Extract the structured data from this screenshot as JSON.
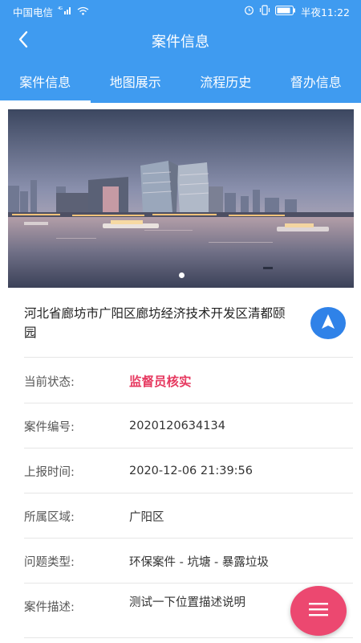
{
  "status_bar": {
    "carrier": "中国电信",
    "signal": "4G",
    "time_label": "半夜11:22"
  },
  "header": {
    "title": "案件信息",
    "back_icon": "chevron-left-icon"
  },
  "tabs": [
    {
      "label": "案件信息",
      "active": true
    },
    {
      "label": "地图展示",
      "active": false
    },
    {
      "label": "流程历史",
      "active": false
    },
    {
      "label": "督办信息",
      "active": false
    }
  ],
  "banner": {
    "description": "city waterfront photo",
    "page_count": 1,
    "current_page": 1
  },
  "location": {
    "address": "河北省廊坊市广阳区廊坊经济技术开发区清都颐园",
    "nav_icon": "navigation-arrow-icon"
  },
  "details": [
    {
      "label": "当前状态:",
      "value": "监督员核实",
      "highlight": true
    },
    {
      "label": "案件编号:",
      "value": "2020120634134",
      "highlight": false
    },
    {
      "label": "上报时间:",
      "value": "2020-12-06 21:39:56",
      "highlight": false
    },
    {
      "label": "所属区域:",
      "value": "广阳区",
      "highlight": false
    },
    {
      "label": "问题类型:",
      "value": "环保案件 - 坑塘 - 暴露垃圾",
      "highlight": false
    },
    {
      "label": "案件描述:",
      "value": "测试一下位置描述说明",
      "highlight": false
    }
  ],
  "fab": {
    "icon": "menu-icon"
  },
  "colors": {
    "primary": "#3f9bf0",
    "status_highlight": "#e6385f",
    "fab": "#ec4870",
    "nav_button": "#2f82e8"
  }
}
